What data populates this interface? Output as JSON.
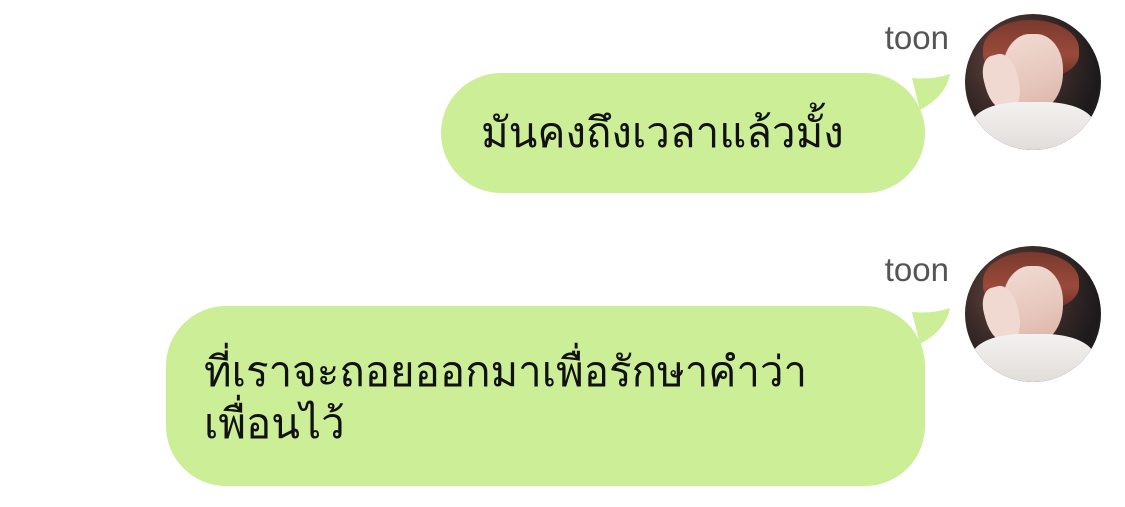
{
  "messages": [
    {
      "sender": "toon",
      "text": "มันคงถึงเวลาแล้วมั้ง"
    },
    {
      "sender": "toon",
      "text": "ที่เราจะถอยออกมาเพื่อรักษาคำว่า\nเพื่อนไว้"
    }
  ],
  "colors": {
    "bubble": "#cbee97",
    "sender_name": "#555555",
    "text": "#111111"
  },
  "icons": {
    "avatar": "profile-photo-avatar"
  }
}
